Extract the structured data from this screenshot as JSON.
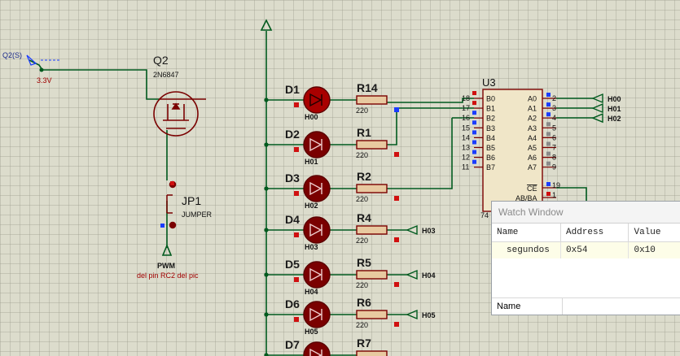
{
  "source": {
    "label": "Q2(S)",
    "voltage": "3.3V"
  },
  "transistor": {
    "ref": "Q2",
    "part": "2N6847"
  },
  "jumper": {
    "ref": "JP1",
    "part": "JUMPER"
  },
  "pwm": {
    "label": "PWM",
    "note": "del pin RC2 del pic"
  },
  "leds": [
    {
      "ref": "D1",
      "net": "H00"
    },
    {
      "ref": "D2",
      "net": "H01"
    },
    {
      "ref": "D3",
      "net": "H02"
    },
    {
      "ref": "D4",
      "net": "H03"
    },
    {
      "ref": "D5",
      "net": "H04"
    },
    {
      "ref": "D6",
      "net": "H05"
    },
    {
      "ref": "D7",
      "net": ""
    }
  ],
  "resistors": [
    {
      "ref": "R14",
      "value": "220"
    },
    {
      "ref": "R1",
      "value": "220"
    },
    {
      "ref": "R2",
      "value": "220"
    },
    {
      "ref": "R4",
      "value": "220",
      "term": "H03"
    },
    {
      "ref": "R5",
      "value": "220",
      "term": "H04"
    },
    {
      "ref": "R6",
      "value": "220",
      "term": "H05"
    },
    {
      "ref": "R7",
      "value": ""
    }
  ],
  "ic": {
    "ref": "U3",
    "part_partial": "74",
    "left_pins": [
      {
        "num": "18",
        "name": "B0"
      },
      {
        "num": "17",
        "name": "B1"
      },
      {
        "num": "16",
        "name": "B2"
      },
      {
        "num": "15",
        "name": "B3"
      },
      {
        "num": "14",
        "name": "B4"
      },
      {
        "num": "13",
        "name": "B5"
      },
      {
        "num": "12",
        "name": "B6"
      },
      {
        "num": "11",
        "name": "B7"
      }
    ],
    "right_pins": [
      {
        "num": "2",
        "name": "A0"
      },
      {
        "num": "3",
        "name": "A1"
      },
      {
        "num": "4",
        "name": "A2"
      },
      {
        "num": "5",
        "name": "A3"
      },
      {
        "num": "6",
        "name": "A4"
      },
      {
        "num": "7",
        "name": "A5"
      },
      {
        "num": "8",
        "name": "A6"
      },
      {
        "num": "9",
        "name": "A7"
      }
    ],
    "ce_pin": {
      "num": "19",
      "name": "CE"
    },
    "ab_pin": {
      "num": "1",
      "name": "AB/BA"
    },
    "outputs": [
      "H00",
      "H01",
      "H02"
    ]
  },
  "watch_window": {
    "title": "Watch Window",
    "columns": [
      "Name",
      "Address",
      "Value"
    ],
    "rows": [
      {
        "name": "segundos",
        "address": "0x54",
        "value": "0x10"
      }
    ],
    "footer": "Name"
  },
  "colors": {
    "wire": "#005a1e",
    "component": "#7a0000",
    "led_fill": "#a80000",
    "pin_red": "#d01010",
    "pin_blue": "#1a3cff"
  }
}
